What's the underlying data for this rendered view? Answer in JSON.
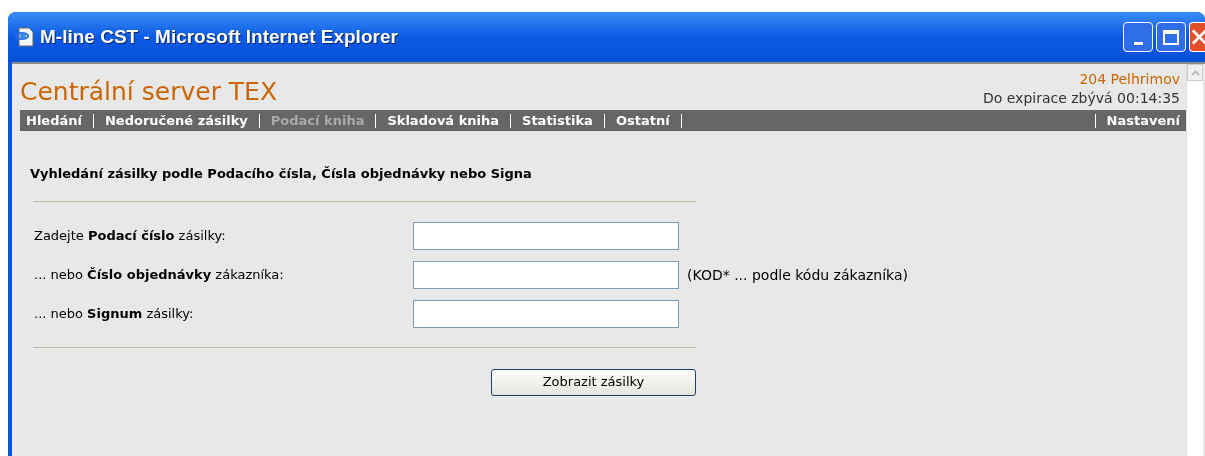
{
  "window": {
    "title": "M-line CST - Microsoft Internet Explorer"
  },
  "header": {
    "title": "Centrální server TEX",
    "location": "204 Pelhrimov",
    "expiry": "Do expirace zbývá 00:14:35"
  },
  "nav": [
    {
      "label": "Hledání",
      "disabled": false
    },
    {
      "label": "Nedoručené zásilky",
      "disabled": false
    },
    {
      "label": "Podací kniha",
      "disabled": true
    },
    {
      "label": "Skladová kniha",
      "disabled": false
    },
    {
      "label": "Statistika",
      "disabled": false
    },
    {
      "label": "Ostatní",
      "disabled": false
    },
    {
      "label": "Nastavení",
      "disabled": false
    }
  ],
  "form": {
    "heading": "Vyhledání zásilky podle Podacího čísla, Čísla objednávky nebo Signa",
    "fields": [
      {
        "label": "Zadejte **Podací číslo** zásilky:"
      },
      {
        "label": "... nebo **Číslo objednávky** zákazníka:",
        "hint": "(KOD* ... podle kódu zákazníka)"
      },
      {
        "label": "... nebo **Signum** zásilky:"
      }
    ],
    "button": "Zobrazit zásilky"
  }
}
